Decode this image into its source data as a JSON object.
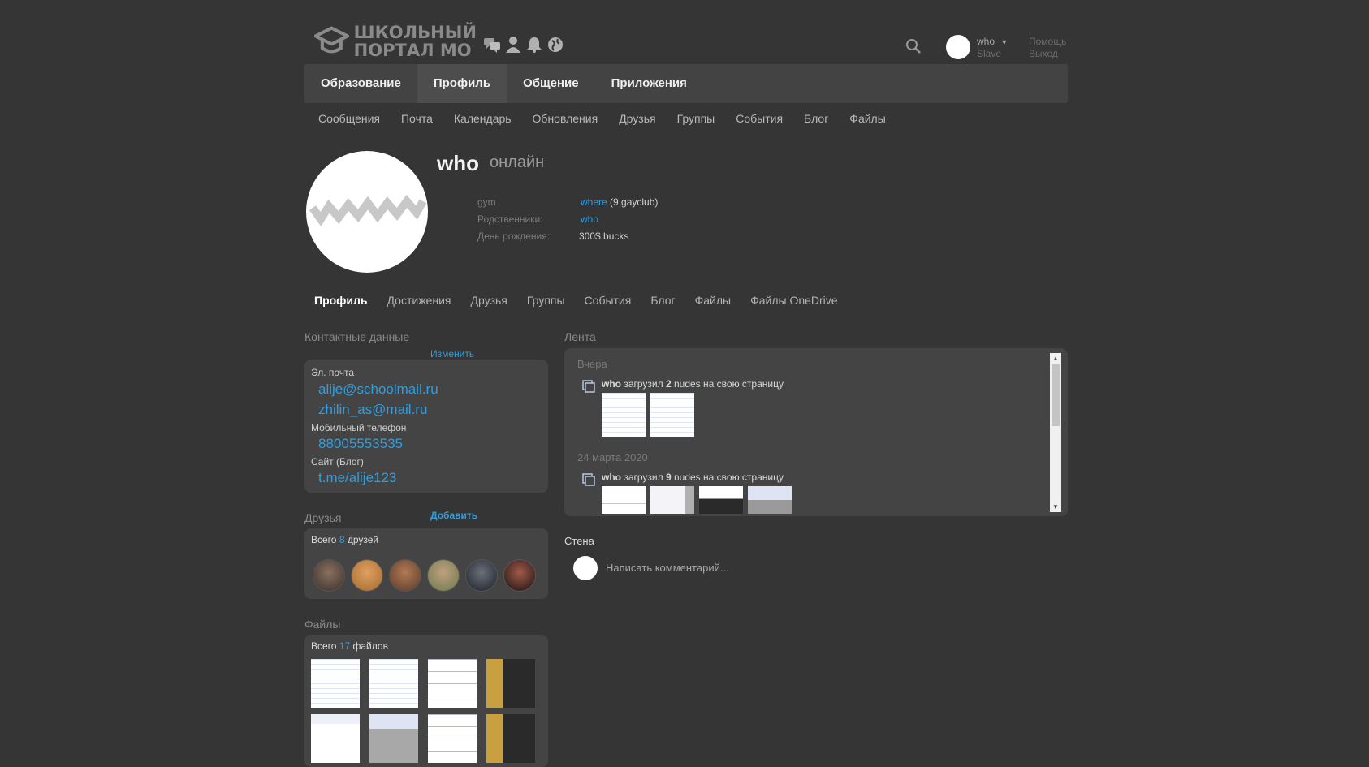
{
  "header": {
    "logo_line1": "ШКОЛЬНЫЙ",
    "logo_line2": "ПОРТАЛ МО",
    "icons": [
      "chat-icon",
      "user-icon",
      "bell-icon",
      "globe-icon"
    ],
    "user": {
      "name": "who",
      "role": "Slave"
    },
    "help": "Помощь",
    "logout": "Выход"
  },
  "main_nav": [
    {
      "label": "Образование",
      "active": false
    },
    {
      "label": "Профиль",
      "active": true
    },
    {
      "label": "Общение",
      "active": false
    },
    {
      "label": "Приложения",
      "active": false
    }
  ],
  "sub_nav": [
    "Сообщения",
    "Почта",
    "Календарь",
    "Обновления",
    "Друзья",
    "Группы",
    "События",
    "Блог",
    "Файлы"
  ],
  "profile": {
    "name": "who",
    "status": "онлайн",
    "info": [
      {
        "key": "gym",
        "link": "where",
        "extra": " (9 gayclub)"
      },
      {
        "key": "Родственники:",
        "link": "who",
        "extra": ""
      },
      {
        "key": "День рождения:",
        "link": "",
        "extra": "300$ bucks"
      }
    ]
  },
  "profile_tabs": [
    {
      "label": "Профиль",
      "active": true
    },
    {
      "label": "Достижения"
    },
    {
      "label": "Друзья"
    },
    {
      "label": "Группы"
    },
    {
      "label": "События"
    },
    {
      "label": "Блог"
    },
    {
      "label": "Файлы"
    },
    {
      "label": "Файлы OneDrive"
    }
  ],
  "contacts": {
    "title": "Контактные данные",
    "edit": "Изменить",
    "email_label": "Эл. почта",
    "emails": [
      "alije@schoolmail.ru",
      "zhilin_as@mail.ru"
    ],
    "phone_label": "Мобильный телефон",
    "phone": "88005553535",
    "site_label": "Сайт (Блог)",
    "site": "t.me/alije123"
  },
  "friends": {
    "title": "Друзья",
    "add": "Добавить",
    "total_prefix": "Всего ",
    "count": "8",
    "total_suffix": " друзей",
    "avatar_colors": [
      "#5a4a3e",
      "#c98a4a",
      "#7a5a44",
      "#8e8060",
      "#3a3f4a",
      "#4a2e2a"
    ]
  },
  "files": {
    "title": "Файлы",
    "total_prefix": "Всего ",
    "count": "17",
    "total_suffix": " файлов"
  },
  "feed": {
    "title": "Лента",
    "groups": [
      {
        "date": "Вчера",
        "user": "who",
        "action": " загрузил ",
        "count": "2",
        "tail": " nudes на свою страницу"
      },
      {
        "date": "24 марта 2020",
        "user": "who",
        "action": " загрузил ",
        "count": "9",
        "tail": " nudes на свою страницу"
      }
    ]
  },
  "wall": {
    "title": "Стена",
    "placeholder": "Написать комментарий..."
  }
}
